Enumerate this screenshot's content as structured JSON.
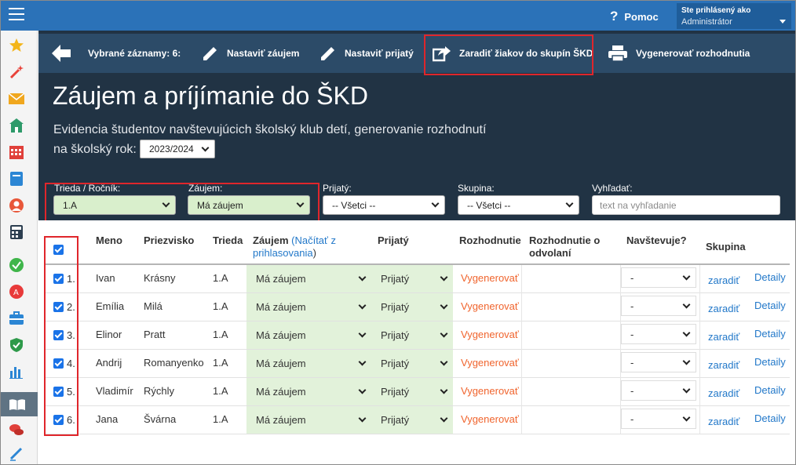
{
  "topbar": {
    "help_label": "Pomoc",
    "user_line1": "Ste prihlásený ako",
    "user_line2": "Administrátor"
  },
  "toolbar": {
    "selected": "Vybrané záznamy: 6:",
    "set_interest": "Nastaviť záujem",
    "set_accepted": "Nastaviť prijatý",
    "assign_groups": "Zaradiť žiakov do skupín ŠKD",
    "generate": "Vygenerovať rozhodnutia"
  },
  "page": {
    "title": "Záujem a príjímanie do ŠKD",
    "subtitle": "Evidencia študentov navštevujúcich školský klub detí, generovanie rozhodnutí",
    "year_label": "na školský rok:",
    "year": "2023/2024"
  },
  "filters": {
    "class_label": "Trieda / Ročník:",
    "class_value": "1.A",
    "interest_label": "Záujem:",
    "interest_value": "Má záujem",
    "accepted_label": "Prijatý:",
    "accepted_value": "-- Všetci --",
    "group_label": "Skupina:",
    "group_value": "-- Všetci --",
    "search_label": "Vyhľadať:",
    "search_placeholder": "text na vyhľadanie"
  },
  "table": {
    "headers": {
      "meno": "Meno",
      "priezvisko": "Priezvisko",
      "trieda": "Trieda",
      "zaujem": "Záujem",
      "nacitat": "(Načítať z",
      "prihlasovania": "prihlasovania",
      "close_paren": ")",
      "prijaty": "Prijatý",
      "rozhodnutie": "Rozhodnutie",
      "odvolanie1": "Rozhodnutie o",
      "odvolanie2": "odvolaní",
      "navstevuje": "Navštevuje?",
      "skupina": "Skupina"
    },
    "rows": [
      {
        "num": "1.",
        "meno": "Ivan",
        "priezvisko": "Krásny",
        "trieda": "1.A",
        "zaujem": "Má záujem",
        "prijaty": "Prijatý",
        "rozhodnutie": "Vygenerovať",
        "navstevuje": "-",
        "skupina": "zaradiť",
        "detail": "Detaily"
      },
      {
        "num": "2.",
        "meno": "Emília",
        "priezvisko": "Milá",
        "trieda": "1.A",
        "zaujem": "Má záujem",
        "prijaty": "Prijatý",
        "rozhodnutie": "Vygenerovať",
        "navstevuje": "-",
        "skupina": "zaradiť",
        "detail": "Detaily"
      },
      {
        "num": "3.",
        "meno": "Elinor",
        "priezvisko": "Pratt",
        "trieda": "1.A",
        "zaujem": "Má záujem",
        "prijaty": "Prijatý",
        "rozhodnutie": "Vygenerovať",
        "navstevuje": "-",
        "skupina": "zaradiť",
        "detail": "Detaily"
      },
      {
        "num": "4.",
        "meno": "Andrij",
        "priezvisko": "Romanyenko",
        "trieda": "1.A",
        "zaujem": "Má záujem",
        "prijaty": "Prijatý",
        "rozhodnutie": "Vygenerovať",
        "navstevuje": "-",
        "skupina": "zaradiť",
        "detail": "Detaily"
      },
      {
        "num": "5.",
        "meno": "Vladimír",
        "priezvisko": "Rýchly",
        "trieda": "1.A",
        "zaujem": "Má záujem",
        "prijaty": "Prijatý",
        "rozhodnutie": "Vygenerovať",
        "navstevuje": "-",
        "skupina": "zaradiť",
        "detail": "Detaily"
      },
      {
        "num": "6.",
        "meno": "Jana",
        "priezvisko": "Švárna",
        "trieda": "1.A",
        "zaujem": "Má záujem",
        "prijaty": "Prijatý",
        "rozhodnutie": "Vygenerovať",
        "navstevuje": "-",
        "skupina": "zaradiť",
        "detail": "Detaily"
      }
    ]
  },
  "colors": {
    "topbar": "#2b72b8",
    "header": "#213344",
    "toolbar": "#2c4b68",
    "highlight": "#e0262b",
    "link": "#2278c9",
    "generate": "#f0642d",
    "green": "#e2f2da"
  },
  "sidebar_icons": [
    "star-icon",
    "magic-wand-icon",
    "envelope-icon",
    "school-icon",
    "calendar-grid-icon",
    "book-icon",
    "student-icon",
    "calculator-icon",
    "check-circle-icon",
    "grade-icon",
    "briefcase-icon",
    "shield-check-icon",
    "bar-chart-icon",
    "open-book-icon",
    "chat-icon",
    "pen-icon"
  ]
}
